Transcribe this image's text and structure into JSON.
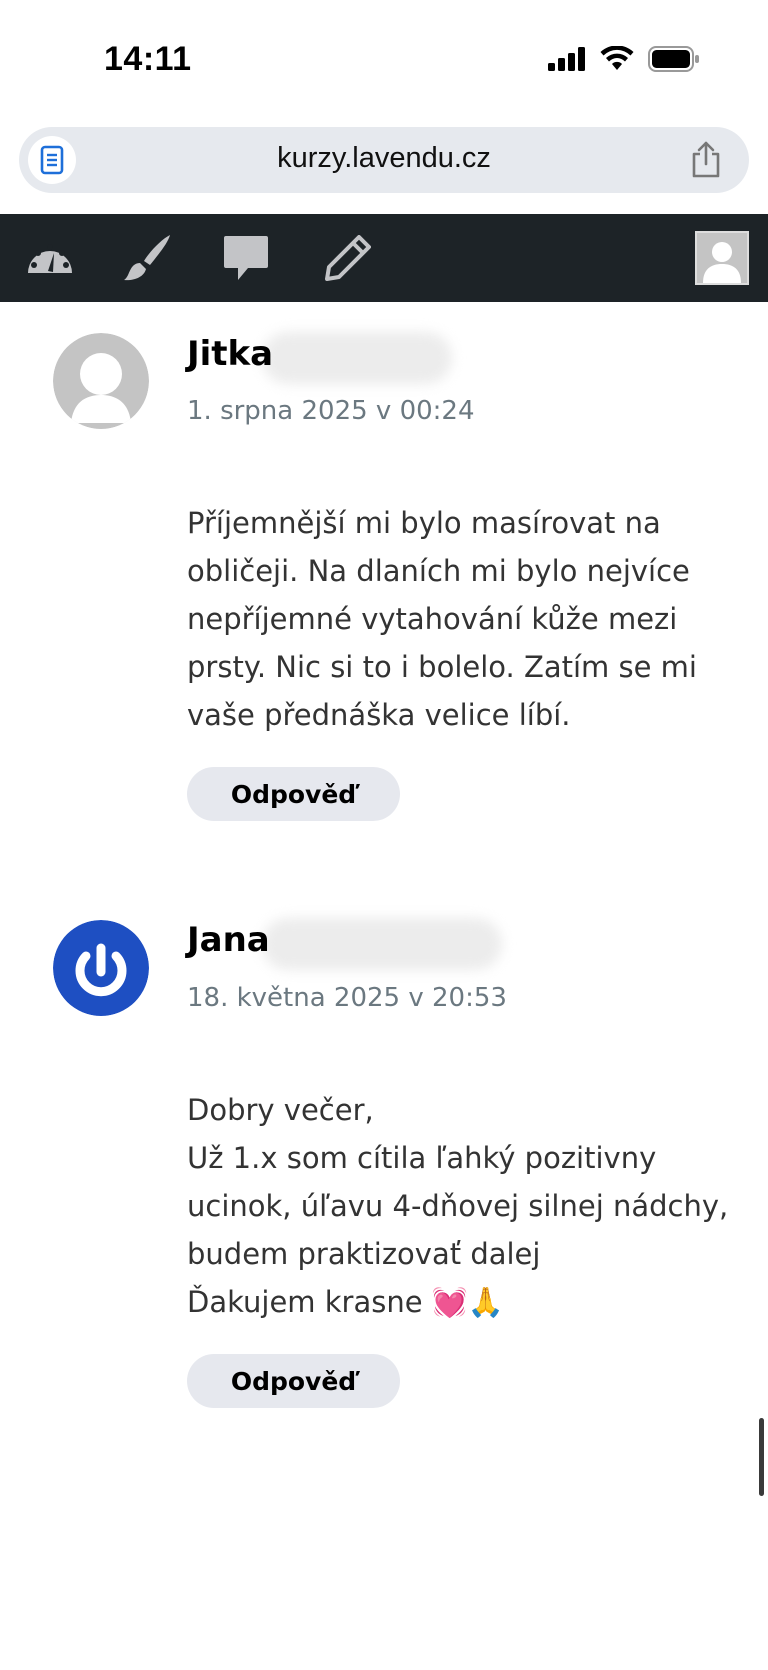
{
  "status_bar": {
    "time": "14:11"
  },
  "browser": {
    "url": "kurzy.lavendu.cz"
  },
  "toolbar": {
    "items": [
      "dashboard-icon",
      "brush-icon",
      "comment-icon",
      "pencil-icon"
    ],
    "background": "#1d2327"
  },
  "comments": [
    {
      "author": "Jitka",
      "date": "1. srpna 2025 v 00:24",
      "avatar": "default-avatar",
      "lines": [
        "Příjemnější mi bylo masírovat na",
        "obličeji. Na dlaních mi bylo nejvíce",
        "nepříjemné vytahování kůže mezi",
        "prsty. Nic si to i bolelo. Zatím se mi",
        "vaše přednáška velice líbí."
      ],
      "reply_label": "Odpověď"
    },
    {
      "author": "Jana",
      "date": "18. května 2025 v 20:53",
      "avatar": "power-avatar",
      "avatar_color": "#1e4fc2",
      "lines": [
        "Dobry večer,",
        "Už 1.x som cítila ľahký pozitivny",
        "ucinok, úľavu 4-dňovej silnej nádchy,",
        "budem praktizovať dalej",
        "Ďakujem krasne 💓🙏"
      ],
      "reply_label": "Odpověď"
    }
  ]
}
